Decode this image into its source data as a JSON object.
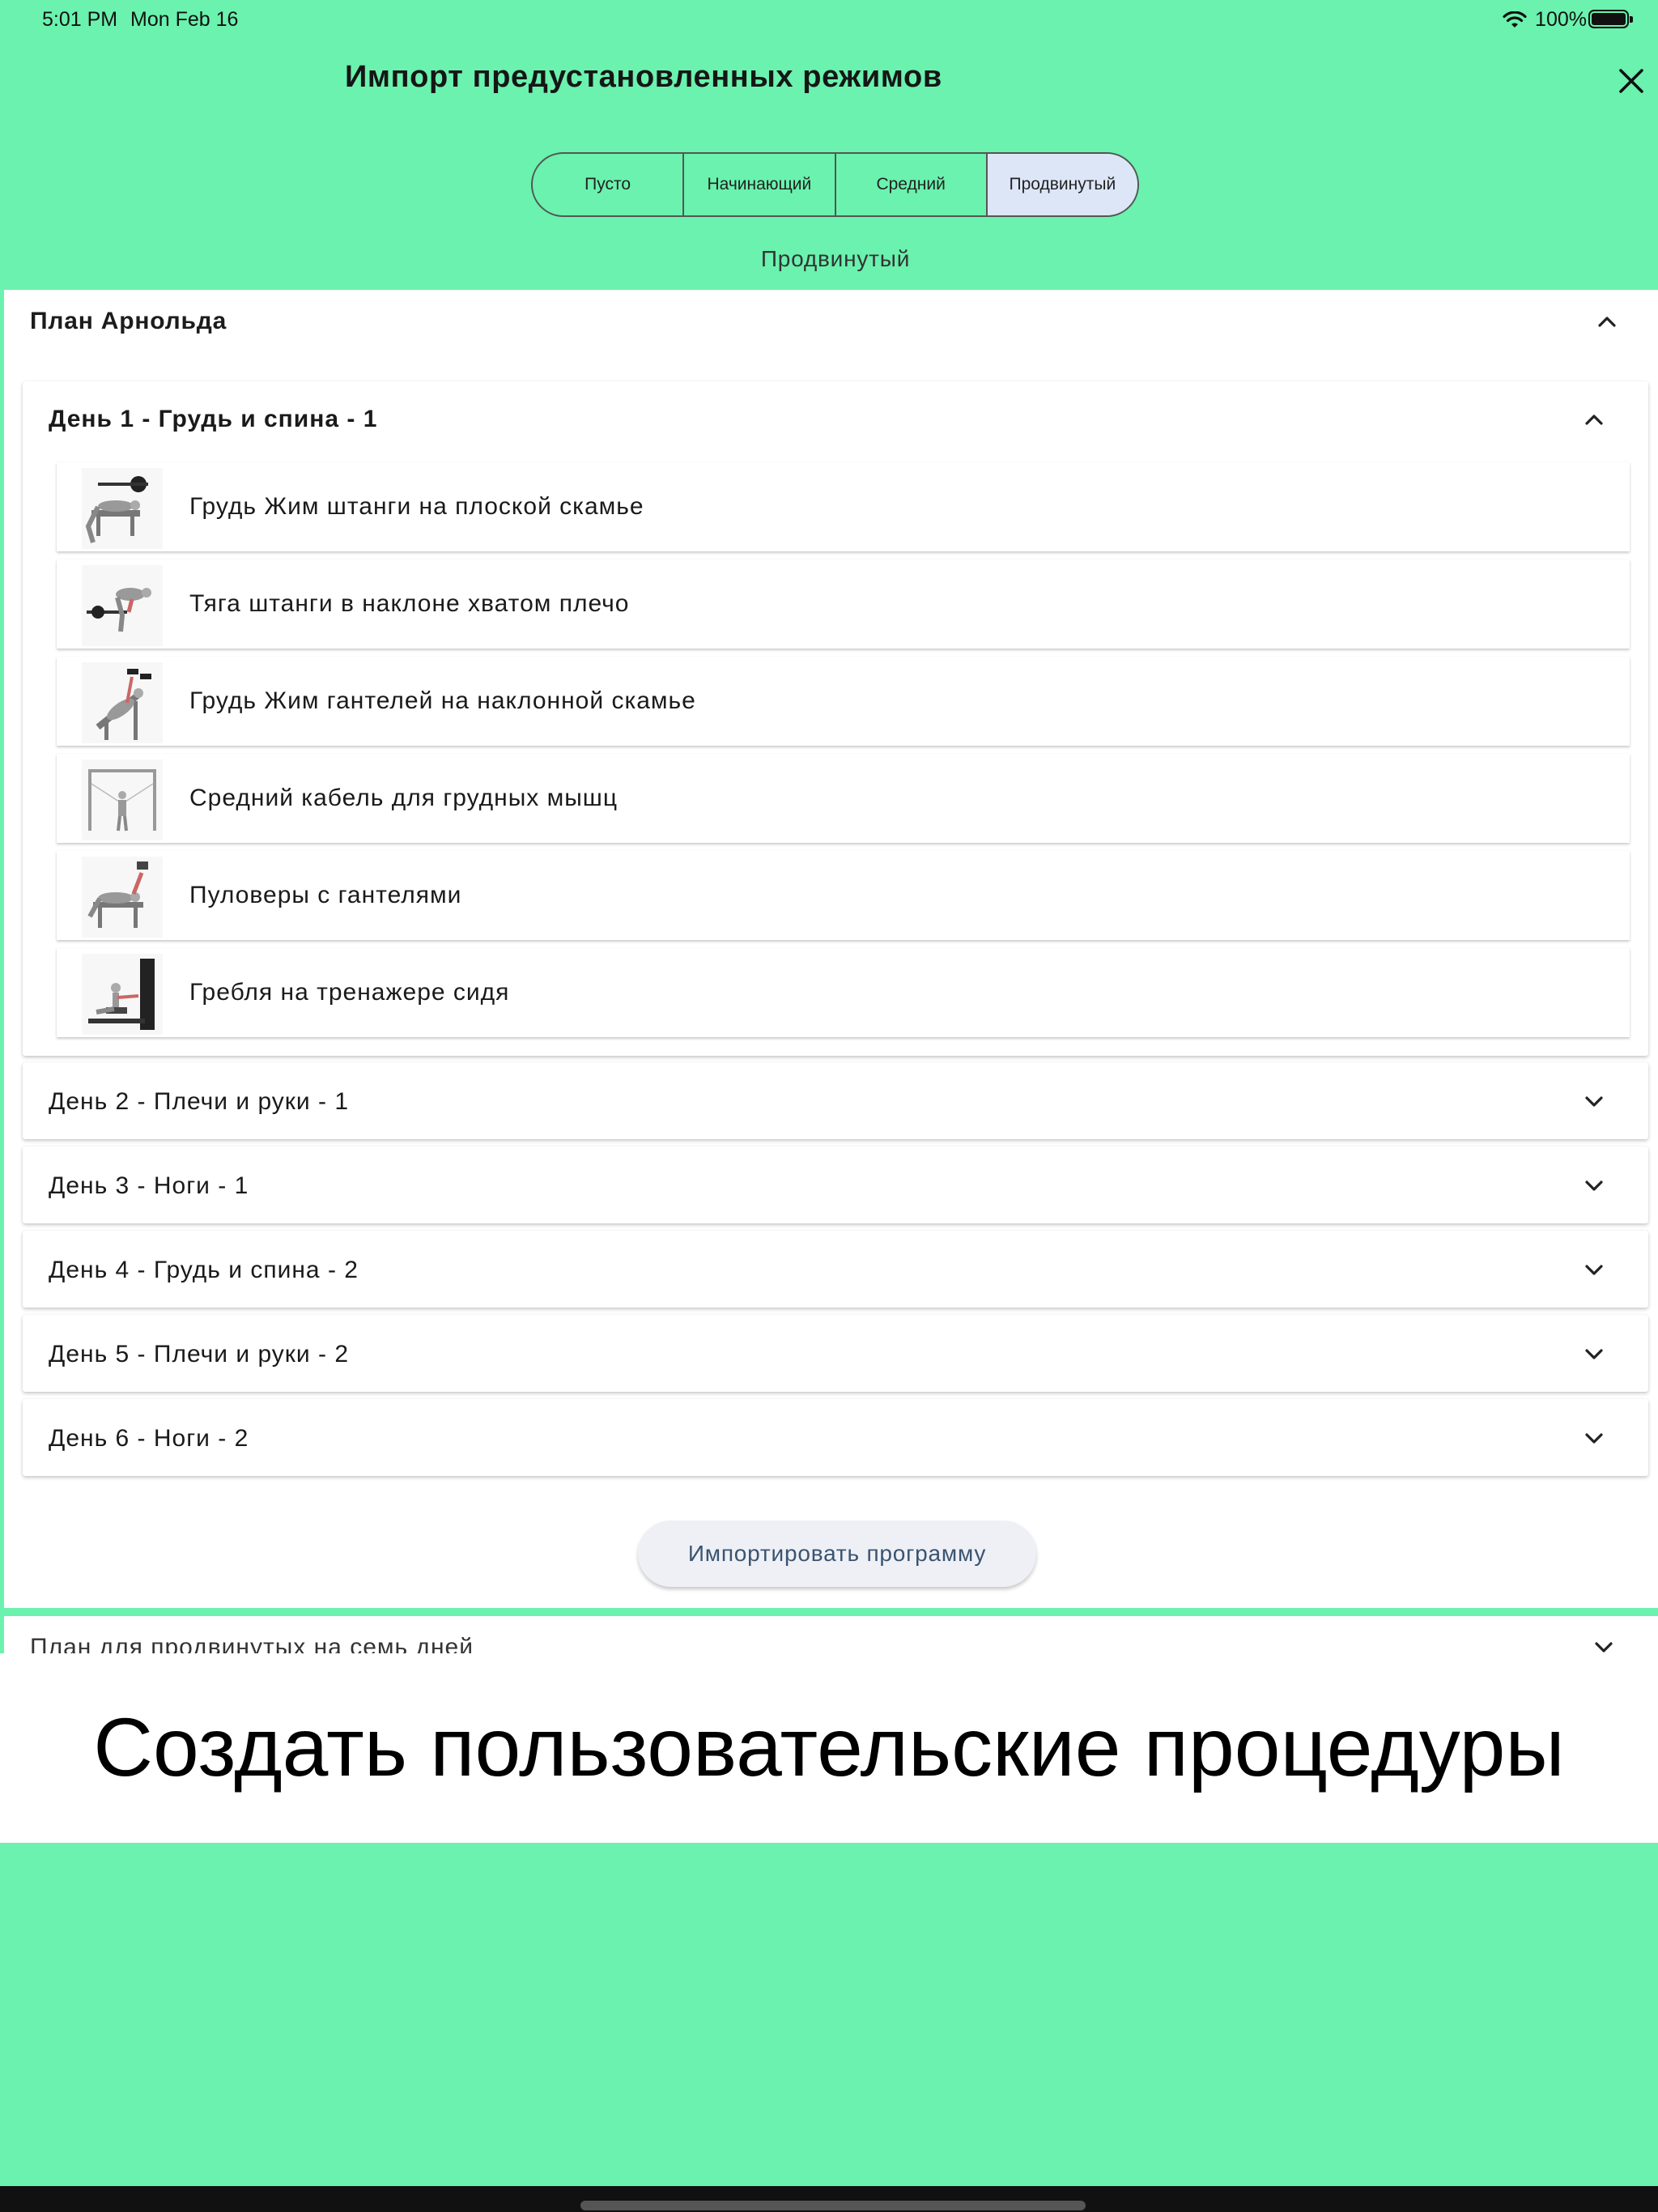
{
  "status_bar": {
    "time": "5:01 PM",
    "date": "Mon Feb 16",
    "battery": "100%",
    "icons": [
      "wifi-icon",
      "battery-icon"
    ]
  },
  "header": {
    "title": "Импорт предустановленных режимов",
    "close_icon": "close-icon"
  },
  "segments": {
    "options": [
      "Пусто",
      "Начинающий",
      "Средний",
      "Продвинутый"
    ],
    "selected": "Продвинутый",
    "caption": "Продвинутый"
  },
  "plan": {
    "title": "План Арнольда",
    "expanded_day": {
      "label": "День 1 - Грудь и спина - 1",
      "exercises": [
        "Грудь Жим штанги на плоской скамье",
        "Тяга штанги в наклоне хватом плечо",
        "Грудь Жим гантелей на наклонной скамье",
        "Средний кабель для грудных мышц",
        "Пуловеры с гантелями",
        "Гребля на тренажере сидя"
      ]
    },
    "collapsed_days": [
      "День 2 - Плечи и руки - 1",
      "День 3 - Ноги - 1",
      "День 4 - Грудь и спина - 2",
      "День 5 - Плечи и руки - 2",
      "День 6 - Ноги - 2"
    ],
    "import_button": "Импортировать программу"
  },
  "next_plan": {
    "label": "План для продвинутых на семь дней"
  },
  "caption": "Создать пользовательские процедуры",
  "colors": {
    "background": "#6af2ae",
    "selected_segment": "#dde6f7",
    "button_text": "#3a5470"
  }
}
